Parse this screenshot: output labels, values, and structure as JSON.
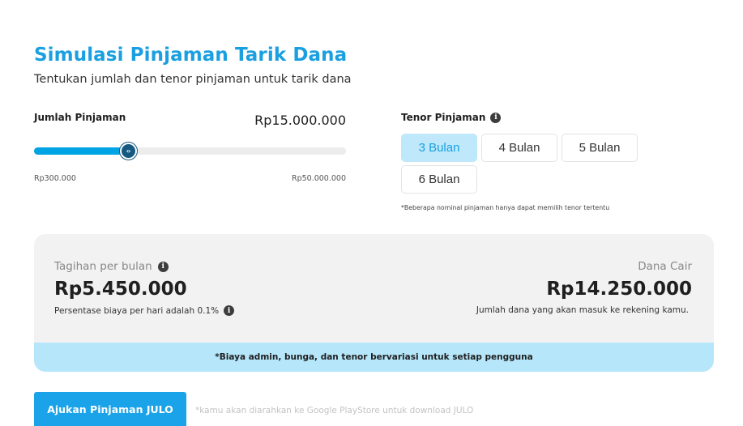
{
  "header": {
    "title": "Simulasi Pinjaman Tarik Dana",
    "subtitle": "Tentukan jumlah dan tenor pinjaman untuk tarik dana"
  },
  "jumlah": {
    "label": "Jumlah Pinjaman",
    "value": "Rp15.000.000",
    "min_label": "Rp300.000",
    "max_label": "Rp50.000.000",
    "slider_fraction": 0.3
  },
  "tenor": {
    "label": "Tenor Pinjaman",
    "options": [
      "3 Bulan",
      "4 Bulan",
      "5 Bulan",
      "6 Bulan"
    ],
    "selected": "3 Bulan",
    "note": "*Beberapa nominal pinjaman hanya dapat memilih tenor tertentu"
  },
  "summary": {
    "tagihan_label": "Tagihan per bulan",
    "tagihan_value": "Rp5.450.000",
    "persentase": "Persentase biaya per hari adalah 0.1%",
    "dana_label": "Dana Cair",
    "dana_value": "Rp14.250.000",
    "dana_note": "Jumlah dana yang akan masuk ke rekening kamu.",
    "disclaimer": "*Biaya admin, bunga, dan tenor bervariasi untuk setiap pengguna"
  },
  "cta": {
    "button_label": "Ajukan Pinjaman JULO",
    "note": "*kamu akan diarahkan ke Google PlayStore untuk download JULO"
  },
  "icons": {
    "info": "info-icon",
    "slider_thumb": "slider-arrows-icon"
  },
  "colors": {
    "accent": "#1a9fe0",
    "slider_fill": "#00a4e4",
    "slider_thumb": "#14597f",
    "tenor_active_bg": "#bfe8fb",
    "disclaimer_bg": "#b5e6fa",
    "card_bg": "#f2f2f2",
    "cta_bg": "#1aa3e8"
  }
}
